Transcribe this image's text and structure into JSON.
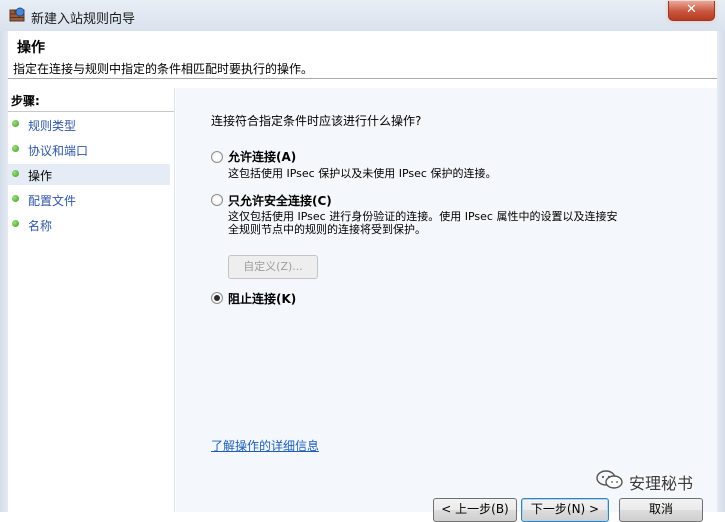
{
  "window": {
    "title": "新建入站规则向导",
    "close_label": "✕",
    "icon": "firewall-shield-icon"
  },
  "header": {
    "title": "操作",
    "description": "指定在连接与规则中指定的条件相匹配时要执行的操作。"
  },
  "steps": {
    "label": "步骤:",
    "items": [
      {
        "label": "规则类型",
        "current": false
      },
      {
        "label": "协议和端口",
        "current": false
      },
      {
        "label": "操作",
        "current": true
      },
      {
        "label": "配置文件",
        "current": false
      },
      {
        "label": "名称",
        "current": false
      }
    ]
  },
  "main": {
    "question": "连接符合指定条件时应该进行什么操作?",
    "options": [
      {
        "label": "允许连接(A)",
        "description": "这包括使用 IPsec 保护以及未使用 IPsec 保护的连接。",
        "checked": false
      },
      {
        "label": "只允许安全连接(C)",
        "description_line1": "这仅包括使用 IPsec 进行身份验证的连接。使用 IPsec 属性中的设置以及连接安",
        "description_line2": "全规则节点中的规则的连接将受到保护。",
        "checked": false
      },
      {
        "label": "阻止连接(K)",
        "checked": true
      }
    ],
    "customize_button": "自定义(Z)...",
    "learn_more_link": "了解操作的详细信息"
  },
  "watermark": {
    "text": "安理秘书",
    "icon": "wechat-icon"
  },
  "buttons": {
    "back": "< 上一步(B)",
    "next": "下一步(N) >",
    "cancel": "取消"
  },
  "colors": {
    "link": "#1d5fb8",
    "step_bullet": "#3f9a25",
    "close_button": "#c9553d",
    "main_background": "#f4f7fb"
  }
}
